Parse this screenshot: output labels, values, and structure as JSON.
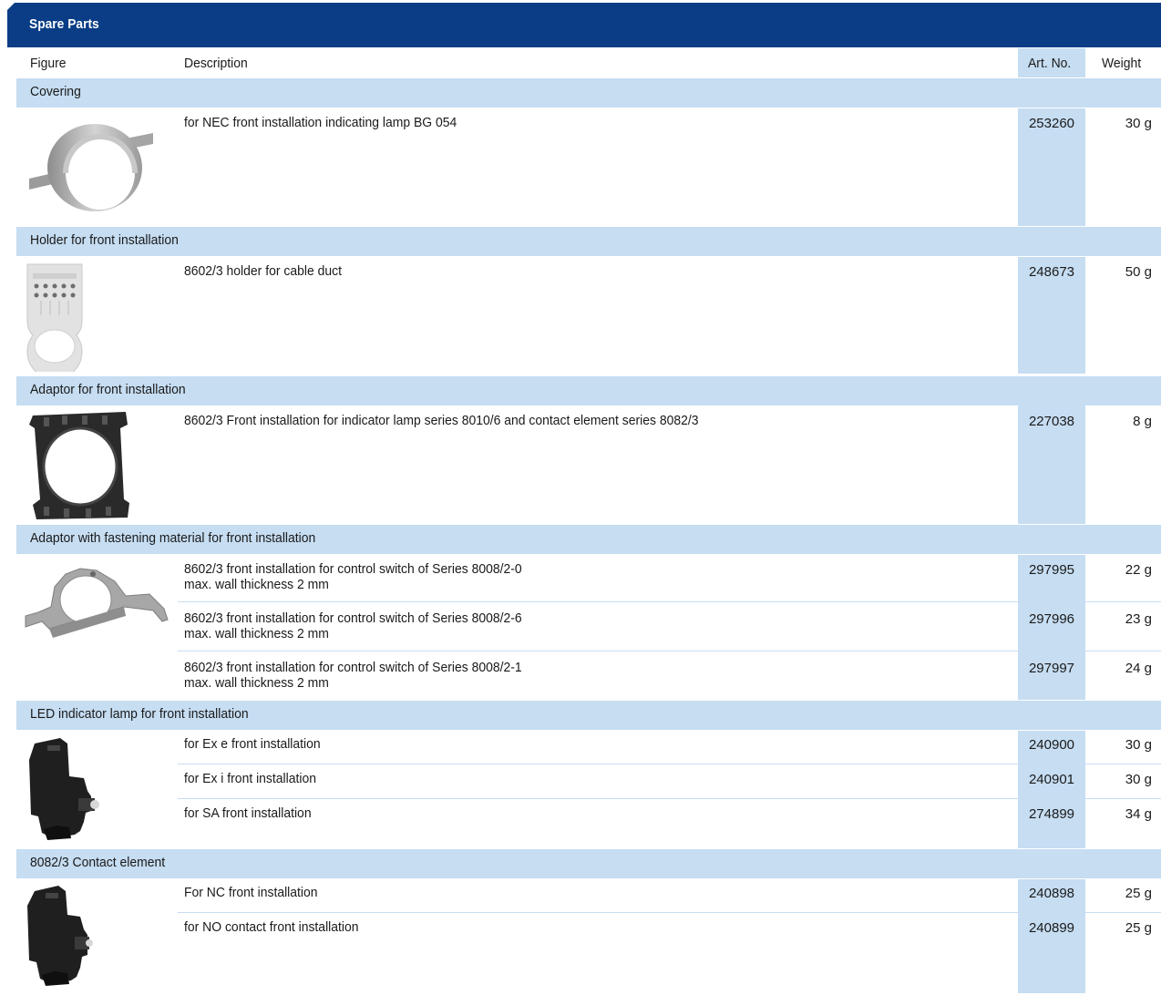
{
  "title": "Spare Parts",
  "columns": {
    "figure": "Figure",
    "description": "Description",
    "art_no": "Art. No.",
    "weight": "Weight"
  },
  "colors": {
    "header_blue": "#0a3d86",
    "light_blue": "#c6ddf2"
  },
  "groups": [
    {
      "name": "Covering",
      "image": "covering-ring-image",
      "items": [
        {
          "desc1": "for NEC front installation indicating lamp BG 054",
          "desc2": "",
          "art_no": "253260",
          "weight": "30 g"
        }
      ]
    },
    {
      "name": "Holder for front installation",
      "image": "holder-plate-image",
      "items": [
        {
          "desc1": "8602/3 holder for cable duct",
          "desc2": "",
          "art_no": "248673",
          "weight": "50 g"
        }
      ]
    },
    {
      "name": "Adaptor for front installation",
      "image": "adaptor-ring-image",
      "items": [
        {
          "desc1": "8602/3 Front installation for indicator lamp series 8010/6 and contact element series 8082/3",
          "desc2": "",
          "art_no": "227038",
          "weight": "8 g"
        }
      ]
    },
    {
      "name": "Adaptor with fastening material for front installation",
      "image": "bracket-image",
      "items": [
        {
          "desc1": "8602/3 front installation for control switch of Series 8008/2-0",
          "desc2": "max. wall thickness 2 mm",
          "art_no": "297995",
          "weight": "22 g"
        },
        {
          "desc1": "8602/3 front installation for control switch of Series 8008/2-6",
          "desc2": "max. wall thickness 2 mm",
          "art_no": "297996",
          "weight": "23 g"
        },
        {
          "desc1": "8602/3 front installation for control switch of Series 8008/2-1",
          "desc2": "max. wall thickness 2 mm",
          "art_no": "297997",
          "weight": "24 g"
        }
      ]
    },
    {
      "name": "LED indicator lamp for front installation",
      "image": "led-module-image",
      "items": [
        {
          "desc1": "for Ex e front installation",
          "desc2": "",
          "art_no": "240900",
          "weight": "30 g"
        },
        {
          "desc1": "for Ex i front installation",
          "desc2": "",
          "art_no": "240901",
          "weight": "30 g"
        },
        {
          "desc1": "for SA front installation",
          "desc2": "",
          "art_no": "274899",
          "weight": "34 g"
        }
      ]
    },
    {
      "name": "8082/3 Contact element",
      "image": "contact-element-image",
      "items": [
        {
          "desc1": "For NC front installation",
          "desc2": "",
          "art_no": "240898",
          "weight": "25 g"
        },
        {
          "desc1": "for NO contact front installation",
          "desc2": "",
          "art_no": "240899",
          "weight": "25 g"
        }
      ]
    }
  ]
}
